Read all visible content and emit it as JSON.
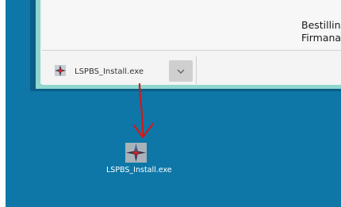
{
  "page": {
    "text_line_1": "Bestillin",
    "text_line_2": "Firmana"
  },
  "download_bar": {
    "filename": "LSPBS_Install.exe",
    "menu_icon": "chevron-down-icon"
  },
  "desktop": {
    "icon_label": "LSPBS_Install.exe",
    "icon": "compass-star-icon"
  },
  "annotation": {
    "arrow_color": "#d01919"
  }
}
